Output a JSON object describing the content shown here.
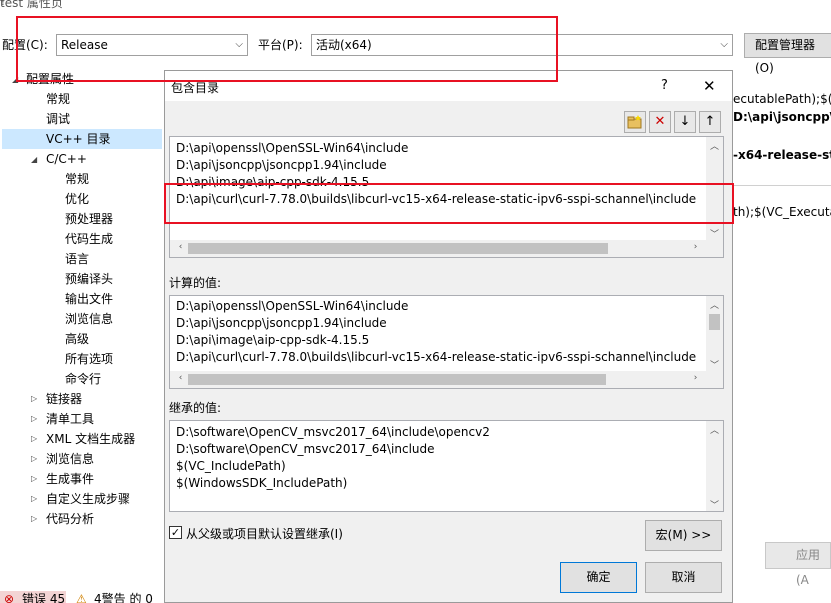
{
  "window": {
    "title": "test 属性页",
    "help": "?"
  },
  "config_row": {
    "config_label": "配置(C):",
    "config_value": "Release",
    "platform_label": "平台(P):",
    "platform_value": "活动(x64)",
    "config_manager_button": "配置管理器(O)"
  },
  "tree": {
    "root": "配置属性",
    "items": [
      {
        "label": "常规"
      },
      {
        "label": "调试"
      },
      {
        "label": "VC++ 目录"
      },
      {
        "label": "C/C++"
      },
      {
        "label": "常规"
      },
      {
        "label": "优化"
      },
      {
        "label": "预处理器"
      },
      {
        "label": "代码生成"
      },
      {
        "label": "语言"
      },
      {
        "label": "预编译头"
      },
      {
        "label": "输出文件"
      },
      {
        "label": "浏览信息"
      },
      {
        "label": "高级"
      },
      {
        "label": "所有选项"
      },
      {
        "label": "命令行"
      },
      {
        "label": "链接器"
      },
      {
        "label": "清单工具"
      },
      {
        "label": "XML 文档生成器"
      },
      {
        "label": "浏览信息"
      },
      {
        "label": "生成事件"
      },
      {
        "label": "自定义生成步骤"
      },
      {
        "label": "代码分析"
      }
    ]
  },
  "background_pane": {
    "line1": "ecutablePath);$(V",
    "line2": "D:\\api\\jsoncpp\\js",
    "line3": "-x64-release-stat",
    "line4": "th);$(VC_Executab",
    "apply_button": "应用(A"
  },
  "dialog": {
    "title": "包含目录",
    "help": "?",
    "close": "✕",
    "include_dirs": [
      "D:\\api\\openssl\\OpenSSL-Win64\\include",
      "D:\\api\\jsoncpp\\jsoncpp1.94\\include",
      "D:\\api\\image\\aip-cpp-sdk-4.15.5",
      "D:\\api\\curl\\curl-7.78.0\\builds\\libcurl-vc15-x64-release-static-ipv6-sspi-schannel\\include"
    ],
    "computed_label": "计算的值:",
    "computed_values": [
      "D:\\api\\openssl\\OpenSSL-Win64\\include",
      "D:\\api\\jsoncpp\\jsoncpp1.94\\include",
      "D:\\api\\image\\aip-cpp-sdk-4.15.5",
      "D:\\api\\curl\\curl-7.78.0\\builds\\libcurl-vc15-x64-release-static-ipv6-sspi-schannel\\include"
    ],
    "inherited_label": "继承的值:",
    "inherited_values": [
      "D:\\software\\OpenCV_msvc2017_64\\include\\opencv2",
      "D:\\software\\OpenCV_msvc2017_64\\include",
      "$(VC_IncludePath)",
      "$(WindowsSDK_IncludePath)"
    ],
    "inherit_checkbox_label": "从父级或项目默认设置继承(I)",
    "inherit_checked": true,
    "macro_button": "宏(M) >>",
    "ok_button": "确定",
    "cancel_button": "取消"
  },
  "status": {
    "errors": "错误 45",
    "warnings": "4警告 的 0"
  },
  "colors": {
    "highlight": "#e81123",
    "selection": "#cce8ff",
    "accent": "#0078d7"
  }
}
